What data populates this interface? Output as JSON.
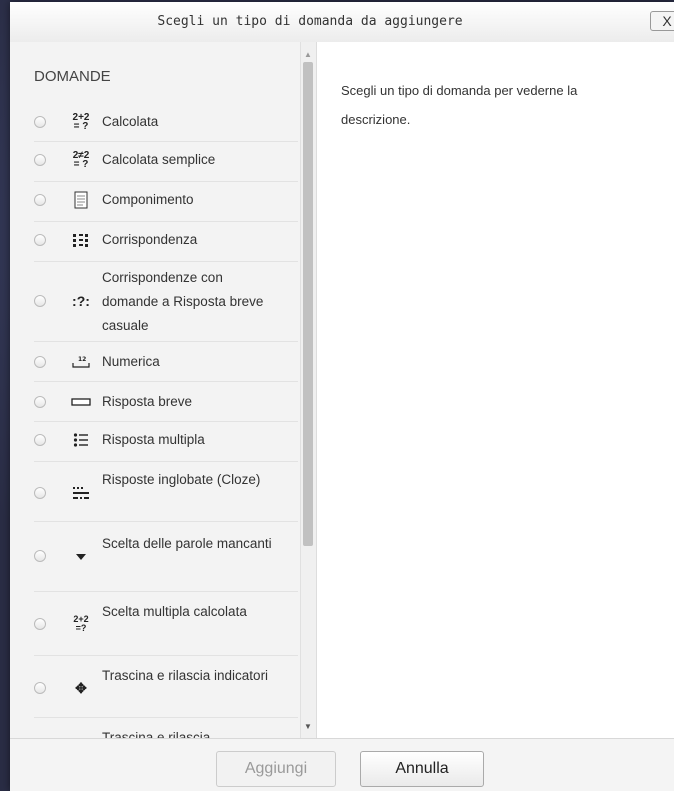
{
  "dialog": {
    "title": "Scegli un tipo di domanda da aggiungere",
    "close_label": "X"
  },
  "questions": {
    "section_header": "DOMANDE",
    "items": [
      {
        "label": "Calcolata",
        "icon": "calculated-icon"
      },
      {
        "label": "Calcolata semplice",
        "icon": "calculated-simple-icon"
      },
      {
        "label": "Componimento",
        "icon": "essay-icon"
      },
      {
        "label": "Corrispondenza",
        "icon": "matching-icon"
      },
      {
        "label": "Corrispondenze con domande a Risposta breve casuale",
        "icon": "random-short-answer-matching-icon"
      },
      {
        "label": "Numerica",
        "icon": "numerical-icon"
      },
      {
        "label": "Risposta breve",
        "icon": "short-answer-icon"
      },
      {
        "label": "Risposta multipla",
        "icon": "multiple-choice-icon"
      },
      {
        "label": "Risposte inglobate (Cloze)",
        "icon": "embedded-answers-icon"
      },
      {
        "label": "Scelta delle parole mancanti",
        "icon": "select-missing-words-icon"
      },
      {
        "label": "Scelta multipla calcolata",
        "icon": "calculated-multichoice-icon"
      },
      {
        "label": "Trascina e rilascia indicatori",
        "icon": "drag-drop-markers-icon"
      },
      {
        "label": "Trascina e rilascia",
        "icon": "drag-drop-icon"
      }
    ]
  },
  "details": {
    "text": "Scegli un tipo di domanda per vederne la descrizione."
  },
  "footer": {
    "add_label": "Aggiungi",
    "cancel_label": "Annulla"
  }
}
